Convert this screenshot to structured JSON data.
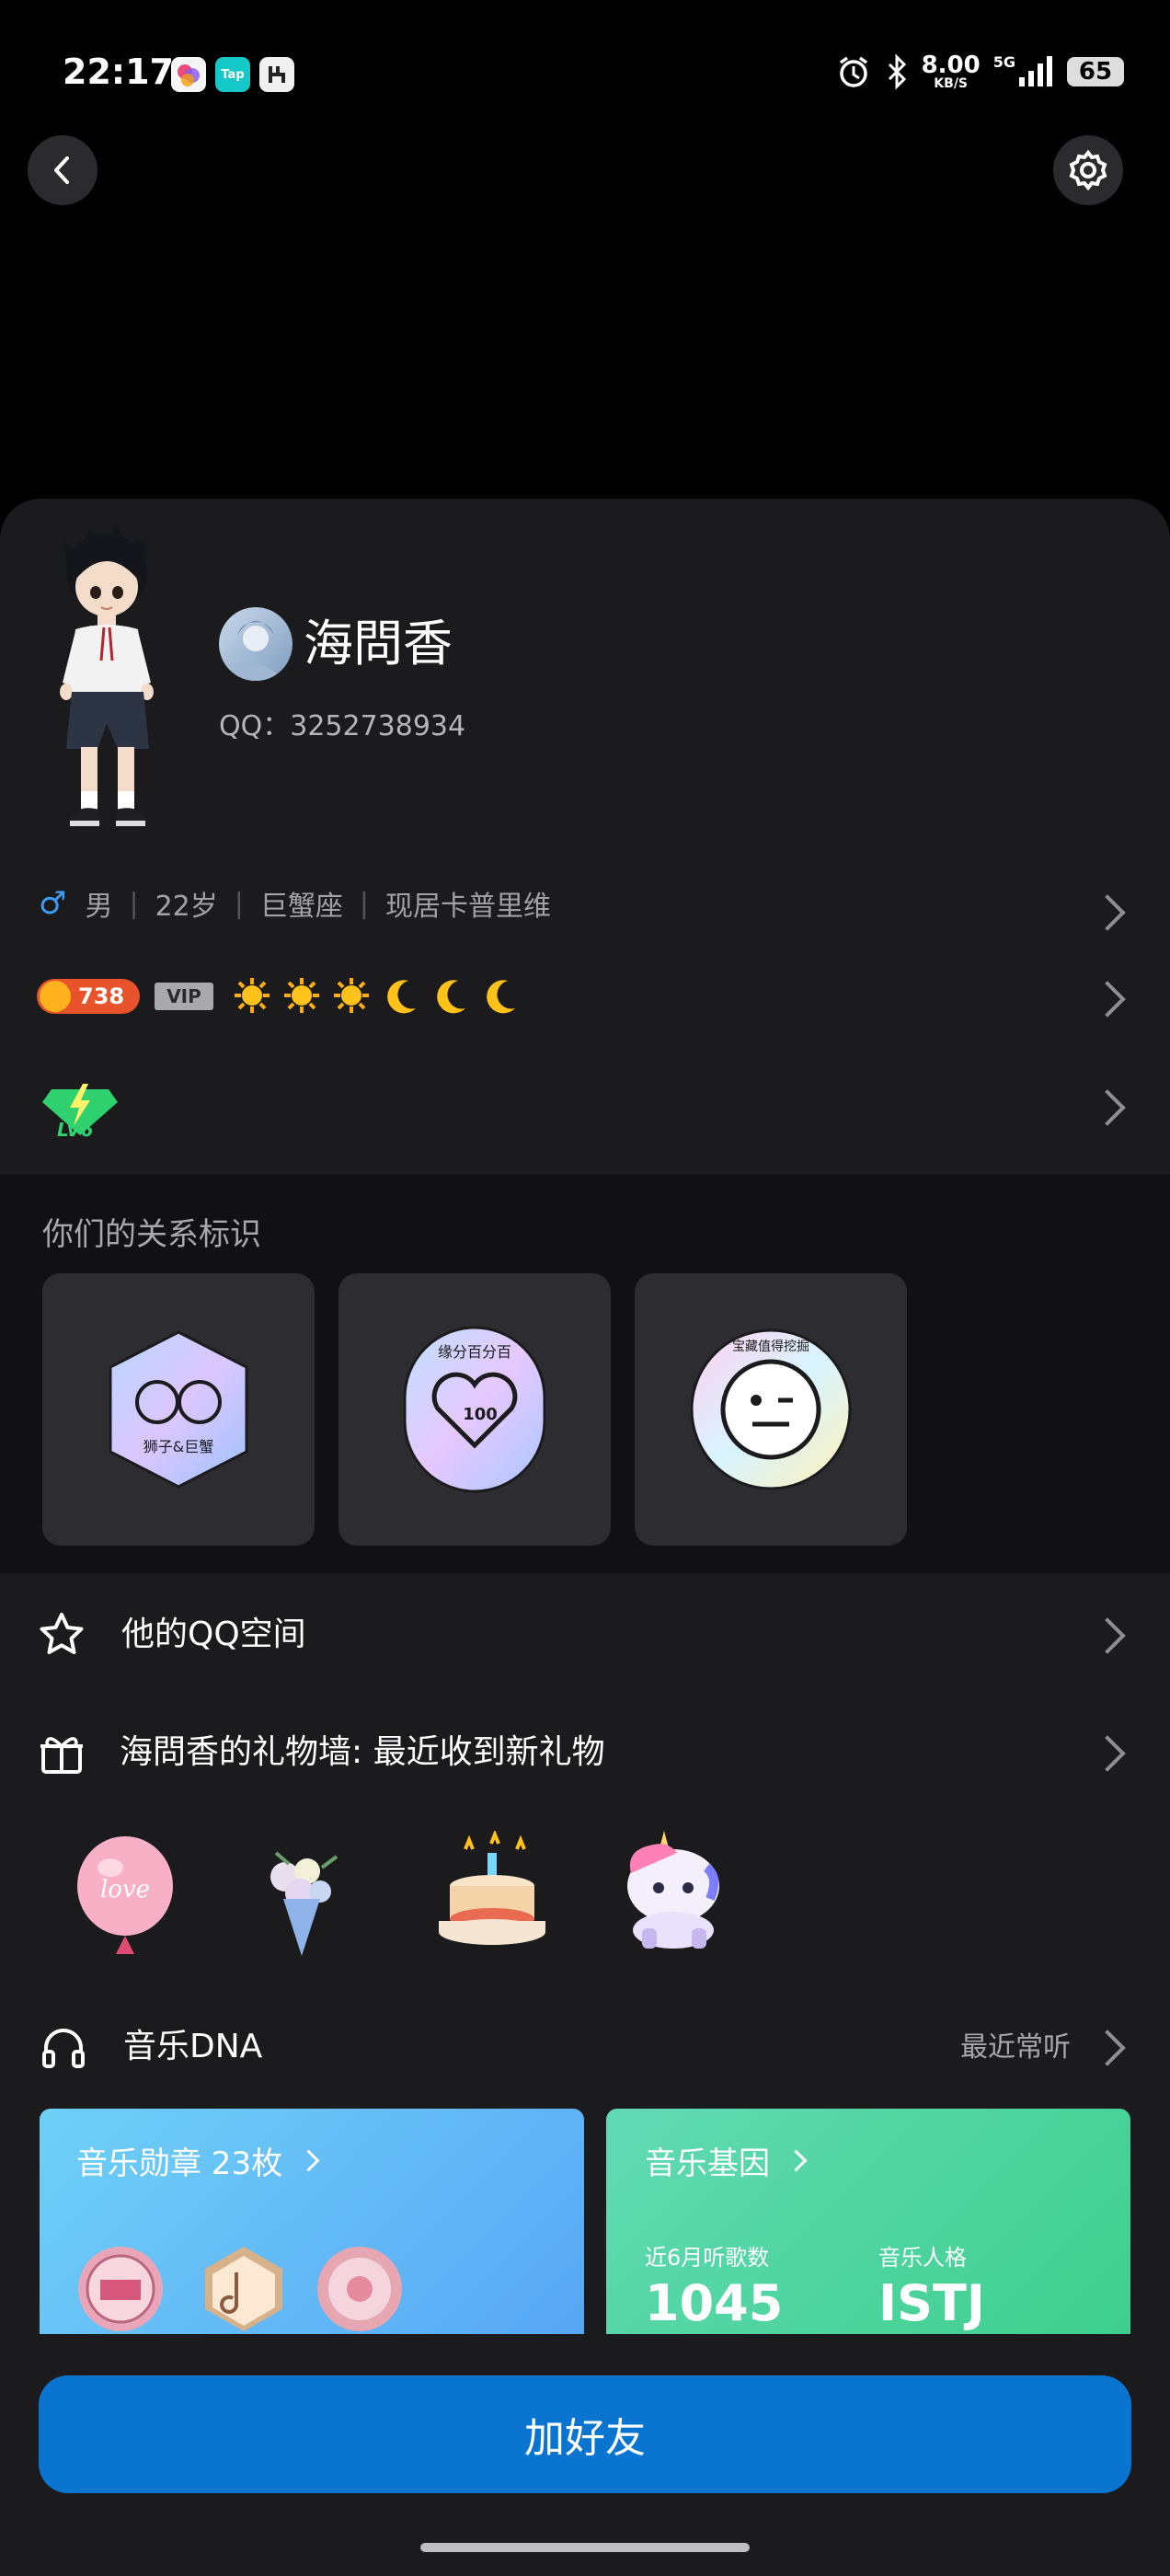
{
  "status_bar": {
    "time": "22:17",
    "net_speed": "8.00",
    "net_unit": "KB/S",
    "network": "5G",
    "battery": "65"
  },
  "profile": {
    "name": "海問香",
    "qq_label": "QQ：3252738934",
    "gender_symbol": "♂",
    "info_items": [
      "男",
      "22岁",
      "巨蟹座",
      "现居卡普里维"
    ],
    "coin_count": "738",
    "vip_label": "VIP",
    "level_label": "LV6"
  },
  "relationship": {
    "title": "你们的关系标识",
    "badges": [
      {
        "label": "狮子&巨蟹"
      },
      {
        "label": "缘分百分百"
      },
      {
        "label": "宝藏值得挖掘"
      }
    ]
  },
  "menu": {
    "qzone_label": "他的QQ空间",
    "gift_label": "海問香的礼物墙: 最近收到新礼物"
  },
  "gifts": [
    "love",
    "",
    "",
    ""
  ],
  "music": {
    "title": "音乐DNA",
    "recent_label": "最近常听",
    "medal_title": "音乐勋章 23枚",
    "gene_title": "音乐基因",
    "listen_label": "近6月听歌数",
    "listen_value": "1045",
    "persona_label": "音乐人格",
    "persona_value": "ISTJ"
  },
  "actions": {
    "add_friend": "加好友"
  },
  "colors": {
    "accent": "#0a74d1",
    "card_bg": "#1b1b1d",
    "gene_gradient": [
      "#62dab4",
      "#3ecf8e"
    ],
    "medal_gradient": [
      "#6fd0f7",
      "#58a7f5"
    ]
  }
}
